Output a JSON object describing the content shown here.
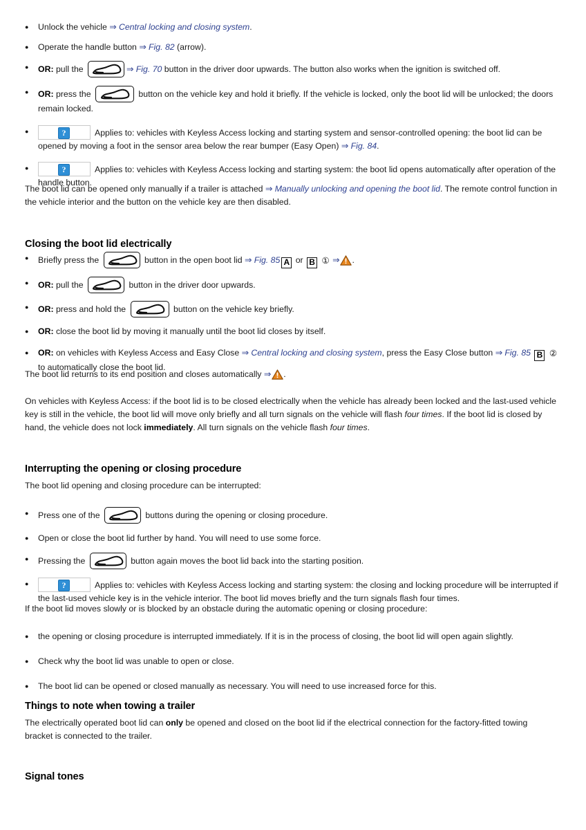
{
  "document": {
    "type": "vehicle-owners-manual-page",
    "topic": "Boot lid operation"
  },
  "colors": {
    "link": "#2c3f8f",
    "warning_triangle": "#e8861e",
    "placeholder_blue": "#2f8fd6",
    "text": "#1a1a1a"
  },
  "icons": {
    "boot_lid_button": "car-boot-open-icon",
    "warning": "warning-triangle-icon",
    "broken_image": "broken-image-placeholder-icon",
    "arrow": "⇒",
    "question_mark": "?"
  },
  "opening_list": {
    "items": [
      {
        "id": "unlock-vehicle",
        "prefix": "",
        "text_before": "Unlock the vehicle ",
        "link": "Central locking and closing system",
        "text_after": "."
      },
      {
        "id": "operate-handle-button",
        "prefix": "",
        "text_before": "Operate the handle button ",
        "link": "Fig. 82",
        "text_after": " (arrow)."
      },
      {
        "id": "pull-driver-door-button",
        "prefix": "OR:",
        "text_before": " pull the ",
        "icon": "car-boot-open-icon",
        "link": "Fig. 70",
        "text_after": " button in the driver door upwards. The button also works when the ignition is switched off."
      },
      {
        "id": "press-vehicle-key-button",
        "prefix": "OR:",
        "text_before": " press the ",
        "icon": "car-boot-open-icon",
        "text_after": " button on the vehicle key and hold it briefly. If the vehicle is locked, only the boot lid will be unlocked; the doors remain locked."
      },
      {
        "id": "keyless-access-easy-open",
        "prefix": "",
        "placeholder": "?",
        "text_before": "Applies to: vehicles with Keyless Access locking and starting system and sensor-controlled opening: the boot lid can be opened by moving a foot in the sensor area below the rear bumper (Easy Open) ",
        "link": "Fig. 84",
        "text_after": "."
      },
      {
        "id": "keyless-access-auto-open",
        "prefix": "",
        "placeholder": "?",
        "text_before": "Applies to: vehicles with Keyless Access locking and starting system: the boot lid opens automatically after operation of the handle button.",
        "text_after": ""
      }
    ]
  },
  "trailer_note": {
    "text_before": "The boot lid can be opened only manually if a trailer is attached ",
    "link": "Manually unlocking and opening the boot lid",
    "text_after": ". The remote control function in the vehicle interior and the button on the vehicle key are then disabled."
  },
  "closing_section": {
    "heading": "Closing the boot lid electrically",
    "items": [
      {
        "id": "briefly-press-boot-button",
        "prefix": "",
        "text_before": "Briefly press the ",
        "icon": "car-boot-open-icon",
        "text_mid": " button in the open boot lid ",
        "link": "Fig. 85",
        "box_a": "A",
        "conjunction": " or ",
        "box_b": "B",
        "circled": "①",
        "text_after": "."
      },
      {
        "id": "pull-driver-door-button-close",
        "prefix": "OR:",
        "text_before": " pull the ",
        "icon": "car-boot-open-icon",
        "text_after": " button in the driver door upwards."
      },
      {
        "id": "press-hold-key-button-close",
        "prefix": "OR:",
        "text_before": " press and hold the ",
        "icon": "car-boot-open-icon",
        "text_after": " button on the vehicle key briefly."
      },
      {
        "id": "close-manually",
        "prefix": "OR:",
        "text_before": " close the boot lid by moving it manually until the boot lid closes by itself.",
        "text_after": ""
      },
      {
        "id": "easy-close-button",
        "prefix": "OR:",
        "text_before": " on vehicles with Keyless Access and Easy Close ",
        "link": "Central locking and closing system",
        "text_mid": ", press the Easy Close button ",
        "link2": "Fig. 85",
        "box_b": "B",
        "circled": "②",
        "text_after": " to automatically close the boot lid."
      }
    ],
    "end_position_note": {
      "text_before": "The boot lid returns to its end position and closes automatically ",
      "text_after": "."
    },
    "keyless_paragraph": {
      "p1": "On vehicles with Keyless Access: if the boot lid is to be closed electrically when the vehicle has already been locked and the last-used vehicle key is still in the vehicle, the boot lid will move only briefly and all turn signals on the vehicle will flash ",
      "em1": "four times",
      "p2": ". If the boot lid is closed by hand, the vehicle does not lock ",
      "strong1": "immediately",
      "p3": ". All turn signals on the vehicle flash ",
      "em2": "four times",
      "p4": "."
    }
  },
  "interrupting_section": {
    "heading": "Interrupting the opening or closing procedure",
    "intro": "The boot lid opening and closing procedure can be interrupted:",
    "items": [
      {
        "id": "press-one-of-buttons",
        "text_before": "Press one of the ",
        "icon": "car-boot-open-icon",
        "text_after": " buttons during the opening or closing procedure."
      },
      {
        "id": "open-close-by-hand",
        "text_before": "Open or close the boot lid further by hand. You will need to use some force.",
        "text_after": ""
      },
      {
        "id": "pressing-button-again",
        "text_before": "Pressing the ",
        "icon": "car-boot-open-icon",
        "text_after": " button again moves the boot lid back into the starting position."
      },
      {
        "id": "keyless-interrupt-note",
        "placeholder": "?",
        "text_before": "Applies to: vehicles with Keyless Access locking and starting system: the closing and locking procedure will be interrupted if the last-used vehicle key is in the vehicle interior. The boot lid moves briefly and the turn signals flash four times.",
        "text_after": ""
      }
    ],
    "obstacle_intro": "If the boot lid moves slowly or is blocked by an obstacle during the automatic opening or closing procedure:",
    "obstacle_items": [
      "the opening or closing procedure is interrupted immediately. If it is in the process of closing, the boot lid will open again slightly.",
      "Check why the boot lid was unable to open or close.",
      "The boot lid can be opened or closed manually as necessary. You will need to use increased force for this."
    ]
  },
  "trailer_section": {
    "heading": "Things to note when towing a trailer",
    "p1": "The electrically operated boot lid can ",
    "strong": "only",
    "p2": " be opened and closed on the boot lid if the electrical connection for the factory-fitted towing bracket is connected to the trailer."
  },
  "signal_section": {
    "heading": "Signal tones"
  }
}
